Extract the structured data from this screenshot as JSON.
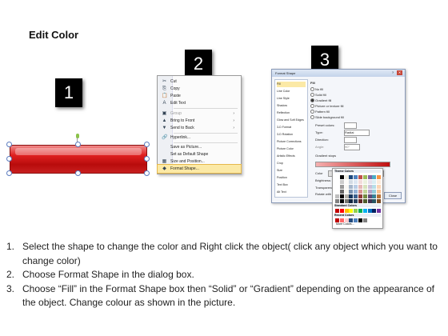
{
  "title": "Edit Color",
  "badges": [
    "1",
    "2",
    "3"
  ],
  "context_menu": {
    "items": [
      {
        "icon": "scissors-icon",
        "glyph": "✂",
        "label": "Cut"
      },
      {
        "icon": "copy-icon",
        "glyph": "⎘",
        "label": "Copy"
      },
      {
        "icon": "paste-icon",
        "glyph": "📋",
        "label": "Paste"
      },
      {
        "icon": "edit-text-icon",
        "glyph": "A",
        "label": "Edit Text"
      },
      {
        "icon": "group-icon",
        "glyph": "▣",
        "label": "Group",
        "arrow": "›",
        "disabled": true
      },
      {
        "icon": "bring-front-icon",
        "glyph": "▲",
        "label": "Bring to Front",
        "arrow": "›"
      },
      {
        "icon": "send-back-icon",
        "glyph": "▼",
        "label": "Send to Back",
        "arrow": "›"
      },
      {
        "icon": "hyperlink-icon",
        "glyph": "🔗",
        "label": "Hyperlink..."
      },
      {
        "icon": "save-picture-icon",
        "glyph": "",
        "label": "Save as Picture..."
      },
      {
        "icon": "default-shape-icon",
        "glyph": "",
        "label": "Set as Default Shape"
      },
      {
        "icon": "size-position-icon",
        "glyph": "▦",
        "label": "Size and Position..."
      },
      {
        "icon": "format-shape-icon",
        "glyph": "◆",
        "label": "Format Shape...",
        "selected": true
      }
    ]
  },
  "dialog": {
    "title": "Format Shape",
    "help": "?",
    "close": "✕",
    "categories": [
      "Fill",
      "Line Color",
      "Line Style",
      "Shadow",
      "Reflection",
      "Glow and Soft Edges",
      "3-D Format",
      "3-D Rotation",
      "Picture Corrections",
      "Picture Color",
      "Artistic Effects",
      "Crop",
      "Size",
      "Position",
      "Text Box",
      "Alt Text"
    ],
    "pane_title": "Fill",
    "fill_options": [
      "No fill",
      "Solid fill",
      "Gradient fill",
      "Picture or texture fill",
      "Pattern fill",
      "Slide background fill"
    ],
    "fields": {
      "preset": "Preset colors:",
      "type": "Type:",
      "type_value": "Radial",
      "direction": "Direction:",
      "angle": "Angle:",
      "angle_value": "90°",
      "stops": "Gradient stops",
      "color": "Color",
      "position": "Position:",
      "position_value": "0%",
      "brightness": "Brightness:",
      "transparency": "Transparency:",
      "rotate": "Rotate with shape"
    },
    "close_button": "Close",
    "popup": {
      "theme": "Theme Colors",
      "standard": "Standard Colors",
      "recent": "Recent Colors",
      "more": "More Colors..."
    }
  },
  "colors": {
    "theme_row": [
      "#ffffff",
      "#000000",
      "#eeece1",
      "#1f497d",
      "#4f81bd",
      "#c0504d",
      "#9bbb59",
      "#8064a2",
      "#4bacc6",
      "#f79646"
    ],
    "standard_row": [
      "#c00000",
      "#ff0000",
      "#ffc000",
      "#ffff00",
      "#92d050",
      "#00b050",
      "#00b0f0",
      "#0070c0",
      "#002060",
      "#7030a0"
    ],
    "recent_row": [
      "#c00000",
      "#ff6666",
      "#ffcccc",
      "#1f497d",
      "#4f81bd",
      "#000000",
      "#7f7f7f"
    ]
  },
  "instructions": [
    {
      "num": "1.",
      "text": "Select the shape to change the color and Right click the object( click any object which you want to change color)"
    },
    {
      "num": "2.",
      "text": "Choose Format Shape in the dialog box."
    },
    {
      "num": "3.",
      "text": "Choose “Fill” in the Format Shape box then “Solid” or “Gradient” depending on the appearance of the object. Change colour as shown in the picture."
    }
  ]
}
